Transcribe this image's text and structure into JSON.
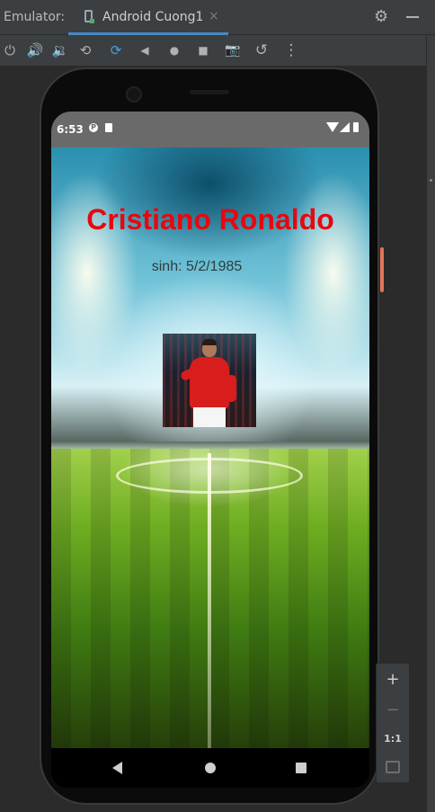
{
  "ide": {
    "panel_label": "Emulator:",
    "device_tab": "Android Cuong1",
    "tab_close": "×",
    "settings_glyph": "⚙",
    "toolbar_glyphs": {
      "power": "⏻",
      "volume_up": "🔊",
      "volume_down": "🔉",
      "rotate_left": "⟲",
      "rotate_right": "⟳",
      "back": "◀",
      "home": "●",
      "overview": "■",
      "screenshot": "📷",
      "snapshot": "↺",
      "more": "⋮"
    }
  },
  "device": {
    "status": {
      "time": "6:53",
      "notification_1": "P"
    },
    "app": {
      "name": "Cristiano Ronaldo",
      "dob": "sinh: 5/2/1985",
      "name_color": "#e8070f"
    }
  },
  "zoom": {
    "zoom_in": "+",
    "zoom_out": "−",
    "actual_size": "1:1"
  },
  "icons": [
    "power-icon",
    "volume-up-icon",
    "volume-down-icon",
    "rotate-left-icon",
    "rotate-right-icon",
    "back-icon",
    "home-icon",
    "overview-icon",
    "camera-icon",
    "snapshot-icon",
    "more-icon",
    "settings-icon",
    "minimize-icon",
    "wifi-icon",
    "signal-icon",
    "battery-icon",
    "fit-screen-icon"
  ]
}
